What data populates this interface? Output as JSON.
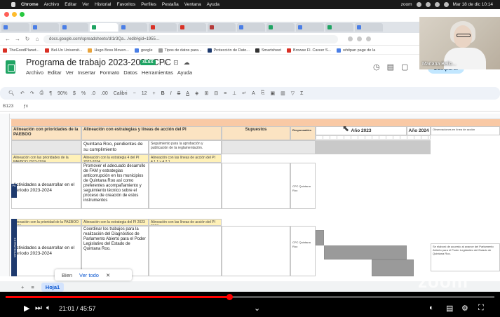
{
  "menubar": {
    "app": "Chrome",
    "items": [
      "Archivo",
      "Editar",
      "Ver",
      "Historial",
      "Favoritos",
      "Perfiles",
      "Pestaña",
      "Ventana",
      "Ayuda"
    ],
    "zoom": "zoom",
    "clock": "Mar 18 de dic 10:14"
  },
  "address": {
    "url": "docs.google.com/spreadsheets/d/1r3Qa…/edit#gid=1955…"
  },
  "bookmarks": [
    "TheGoodPlanet...",
    "Bel-Un Universit...",
    "Hugo Boss Moven...",
    "google",
    "Tipos de datos para...",
    "Protección de Dato...",
    "Smartsheet",
    "Browse Fl. Career S...",
    "whitpan page de la"
  ],
  "sheet": {
    "title": "Programa de trabajo 2023-2024 CPC",
    "badge": "XLSX",
    "menus": [
      "Archivo",
      "Editar",
      "Ver",
      "Insertar",
      "Formato",
      "Datos",
      "Herramientas",
      "Ayuda"
    ],
    "share": "Compartir"
  },
  "webcam": {
    "name": "Mariana Bello..."
  },
  "toolbar": {
    "zoom": "90%",
    "font": "Calibri",
    "size": "12",
    "cellref": "B123"
  },
  "grid": {
    "headers": {
      "col_a": "Alineación con prioridades de la PAEBOO",
      "col_b": "Alineación con estrategias y líneas de acción del PI",
      "col_c": "Supuestos",
      "col_d": "Responsables",
      "year1": "Año 2023",
      "year2": "Año 2024",
      "obs": "Observaciones en línea de acción"
    },
    "rows": {
      "r1_text": "Quintana Roo, pendientes de su cumplimiento",
      "r1_desc": "Seguimiento para la aprobación y publicación de la reglamentación.",
      "r2_yellow_a": "Alineación con las prioridades de la PAEBOO 2023-2024",
      "r2_yellow_b": "Alineación con la estrategia 4 del PI 2022-2024",
      "r2_yellow_c": "Alineación con las líneas de acción del PI 4.1.1 y 4.2.1",
      "r3_label": "Actividades a desarrollar en el período 2023-2024",
      "r3_text": "Promover el adecuado desarrollo de FAM y estrategias anticorrupción en los municipios de Quintana Roo así como preferentes acompañamiento y seguimiento técnico sobre el proceso de creación de estos instrumentos",
      "r3_resp": "CPC Quintana Roo",
      "r4_yellow_a": "Alineación con la prioridad de la PAEBOO 2023",
      "r4_yellow_b": "Alineación con la estrategia del PI 2023",
      "r4_yellow_c": "Alineación con las líneas de acción del PI 2023",
      "r5_label": "Actividades a desarrollar en el período 2023-2024",
      "r5_text": "Coordinar los trabajos para la realización del Diagnóstico de Parlamento Abierto para el Poder Legislativo del Estado de Quintana Roo.",
      "r5_resp": "CPC Quintana Roo",
      "r5_obs": "Se elaboró de acuerdo al avance del Parlamento Abierto para el Poder Legislativo del Estado de Quintana Roo."
    }
  },
  "navy_labels": {
    "left_top": "PA",
    "left_mid": "ESTRATEGIAS"
  },
  "tabs": {
    "sheet_tab": "Hoja1",
    "popup_left": "Bien",
    "popup_link": "Ver todo"
  },
  "video": {
    "time": "21:01 / 45:57",
    "progress": 0.458,
    "watermark": "zoom"
  }
}
